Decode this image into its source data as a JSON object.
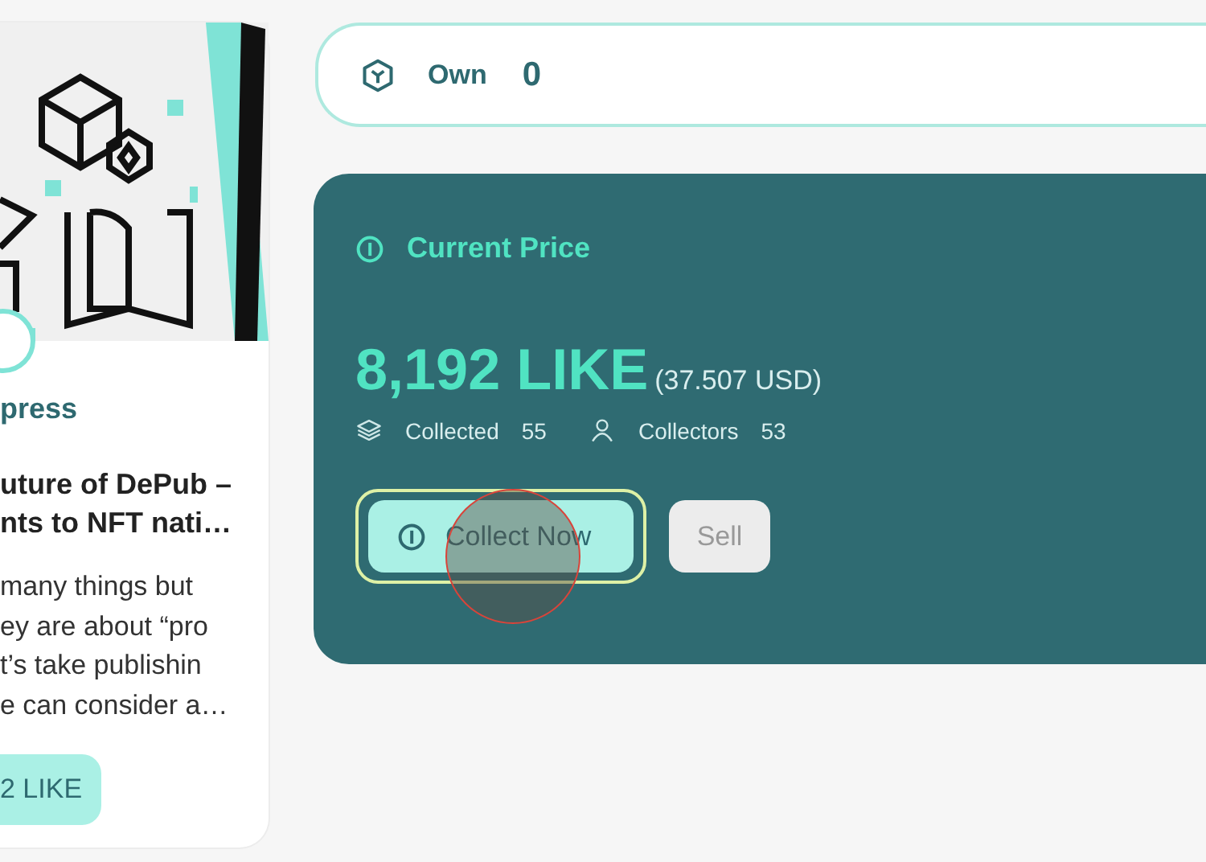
{
  "article_card": {
    "publisher": "press",
    "title_lines": [
      "uture of DePub –",
      "nts to NFT nati…"
    ],
    "excerpt_lines": [
      "many things but",
      "ey are about “pro",
      "t’s take publishin",
      "e can consider a…"
    ],
    "price_button": "2 LIKE"
  },
  "own": {
    "label": "Own",
    "value": "0"
  },
  "price_panel": {
    "title": "Current Price",
    "price": "8,192 LIKE",
    "fiat": "(37.507 USD)",
    "stats": [
      {
        "kind": "collected",
        "label": "Collected",
        "value": "55"
      },
      {
        "kind": "collectors",
        "label": "Collectors",
        "value": "53"
      }
    ],
    "buttons": [
      {
        "kind": "primary",
        "label": "Collect Now"
      },
      {
        "kind": "secondary",
        "label": "Sell"
      }
    ]
  }
}
